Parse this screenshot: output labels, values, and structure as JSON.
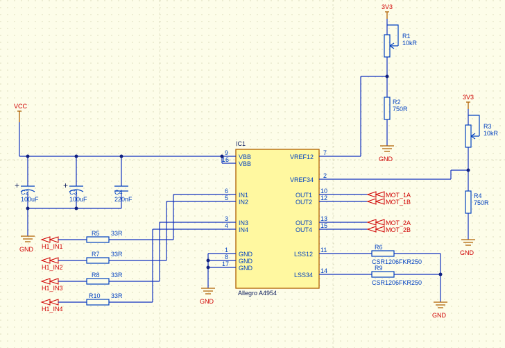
{
  "power": {
    "vcc": "VCC",
    "v33": "3V3",
    "gnd": "GND"
  },
  "caps": {
    "c2": {
      "ref": "C2",
      "val": "100uF"
    },
    "c3": {
      "ref": "C3",
      "val": "100uF"
    },
    "c4": {
      "ref": "C4",
      "val": "220nF"
    }
  },
  "res": {
    "r1": {
      "ref": "R1",
      "val": "10kR"
    },
    "r2": {
      "ref": "R2",
      "val": "750R"
    },
    "r3": {
      "ref": "R3",
      "val": "10kR"
    },
    "r4": {
      "ref": "R4",
      "val": "750R"
    },
    "r5": {
      "ref": "R5",
      "val": "33R"
    },
    "r6": {
      "ref": "R6",
      "val": "CSR1206FKR250"
    },
    "r7": {
      "ref": "R7",
      "val": "33R"
    },
    "r8": {
      "ref": "R8",
      "val": "33R"
    },
    "r9": {
      "ref": "R9",
      "val": "CSR1206FKR250"
    },
    "r10": {
      "ref": "R10",
      "val": "33R"
    }
  },
  "ic": {
    "ref": "IC1",
    "part": "Allegro A4954",
    "pins": {
      "vbb1": {
        "num": "9",
        "name": "VBB"
      },
      "vbb2": {
        "num": "16",
        "name": "VBB"
      },
      "vref12": {
        "num": "7",
        "name": "VREF12"
      },
      "vref34": {
        "num": "2",
        "name": "VREF34"
      },
      "in1": {
        "num": "6",
        "name": "IN1"
      },
      "in2": {
        "num": "5",
        "name": "IN2"
      },
      "in3": {
        "num": "3",
        "name": "IN3"
      },
      "in4": {
        "num": "4",
        "name": "IN4"
      },
      "out1": {
        "num": "10",
        "name": "OUT1"
      },
      "out2": {
        "num": "12",
        "name": "OUT2"
      },
      "out3": {
        "num": "13",
        "name": "OUT3"
      },
      "out4": {
        "num": "15",
        "name": "OUT4"
      },
      "gnd1": {
        "num": "1",
        "name": "GND"
      },
      "gnd2": {
        "num": "8",
        "name": "GND"
      },
      "gnd3": {
        "num": "17",
        "name": "GND"
      },
      "lss12": {
        "num": "11",
        "name": "LSS12"
      },
      "lss34": {
        "num": "14",
        "name": "LSS34"
      }
    }
  },
  "nets": {
    "in1": "H1_IN1",
    "in2": "H1_IN2",
    "in3": "H1_IN3",
    "in4": "H1_IN4",
    "m1a": "MOT_1A",
    "m1b": "MOT_1B",
    "m2a": "MOT_2A",
    "m2b": "MOT_2B"
  }
}
